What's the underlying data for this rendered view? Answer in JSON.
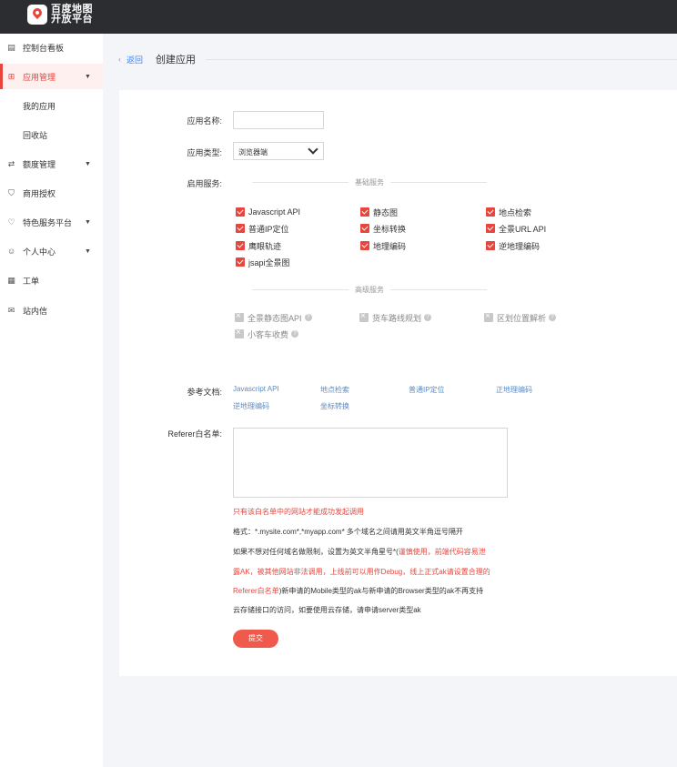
{
  "brand": {
    "line1": "百度地图",
    "line2": "开放平台"
  },
  "sidebar": {
    "items": [
      {
        "label": "控制台看板",
        "icon": "dashboard-icon",
        "glyph": "▤"
      },
      {
        "label": "应用管理",
        "icon": "apps-grid-icon",
        "glyph": "⊞",
        "arrow": "▼"
      },
      {
        "label": "我的应用"
      },
      {
        "label": "回收站"
      },
      {
        "label": "额度管理",
        "icon": "quota-icon",
        "glyph": "⇄",
        "arrow": "▼"
      },
      {
        "label": "商用授权",
        "icon": "shield-icon",
        "glyph": "⛉"
      },
      {
        "label": "特色服务平台",
        "icon": "heart-icon",
        "glyph": "♡",
        "arrow": "▼"
      },
      {
        "label": "个人中心",
        "icon": "user-icon",
        "glyph": "☺",
        "arrow": "▼"
      },
      {
        "label": "工单",
        "icon": "ticket-icon",
        "glyph": "▦"
      },
      {
        "label": "站内信",
        "icon": "mail-icon",
        "glyph": "✉"
      }
    ]
  },
  "breadcrumb": {
    "chevron": "‹",
    "back": "返回",
    "title": "创建应用"
  },
  "form": {
    "app_name_label": "应用名称:",
    "app_name_value": "",
    "app_type_label": "应用类型:",
    "app_type_value": "浏览器端",
    "services_label": "启用服务:",
    "basic_divider": "基础服务",
    "advanced_divider": "高级服务",
    "basic_services": [
      "Javascript API",
      "静态图",
      "地点检索",
      "普通IP定位",
      "坐标转换",
      "全景URL API",
      "鹰眼轨迹",
      "地理编码",
      "逆地理编码",
      "jsapi全景图"
    ],
    "advanced_services": [
      {
        "label": "全景静态图API",
        "help": "?"
      },
      {
        "label": "货车路线规划",
        "help": "?"
      },
      {
        "label": "区划位置解析",
        "help": "?"
      },
      {
        "label": "小客车收费",
        "help": "?"
      }
    ],
    "docs_label": "参考文档:",
    "docs": [
      "Javascript API",
      "地点检索",
      "普通IP定位",
      "正地理编码",
      "逆地理编码",
      "坐标转换"
    ],
    "referer_label": "Referer白名单:",
    "referer_value": "",
    "note_red": "只有该白名单中的网站才能成功发起调用",
    "note_format": "格式：*.mysite.com*,*myapp.com* 多个域名之间请用英文半角逗号隔开",
    "note_l1_a": "如果不想对任何域名做限制，设置为英文半角星号*(",
    "note_l1_b": "谨慎使用，前端代码容易泄",
    "note_l2": "露AK，被其他网站非法调用，上线前可以用作Debug，线上正式ak请设置合理的",
    "note_l3_a": "Referer白名单",
    "note_l3_b": ")新申请的Mobile类型的ak与新申请的Browser类型的ak不再支持",
    "note_l4": "云存储接口的访问，如要使用云存储，请申请server类型ak",
    "submit_label": "提交"
  },
  "colors": {
    "accent": "#e8453c",
    "link": "#3385ff",
    "topbar": "#2b2d30"
  }
}
